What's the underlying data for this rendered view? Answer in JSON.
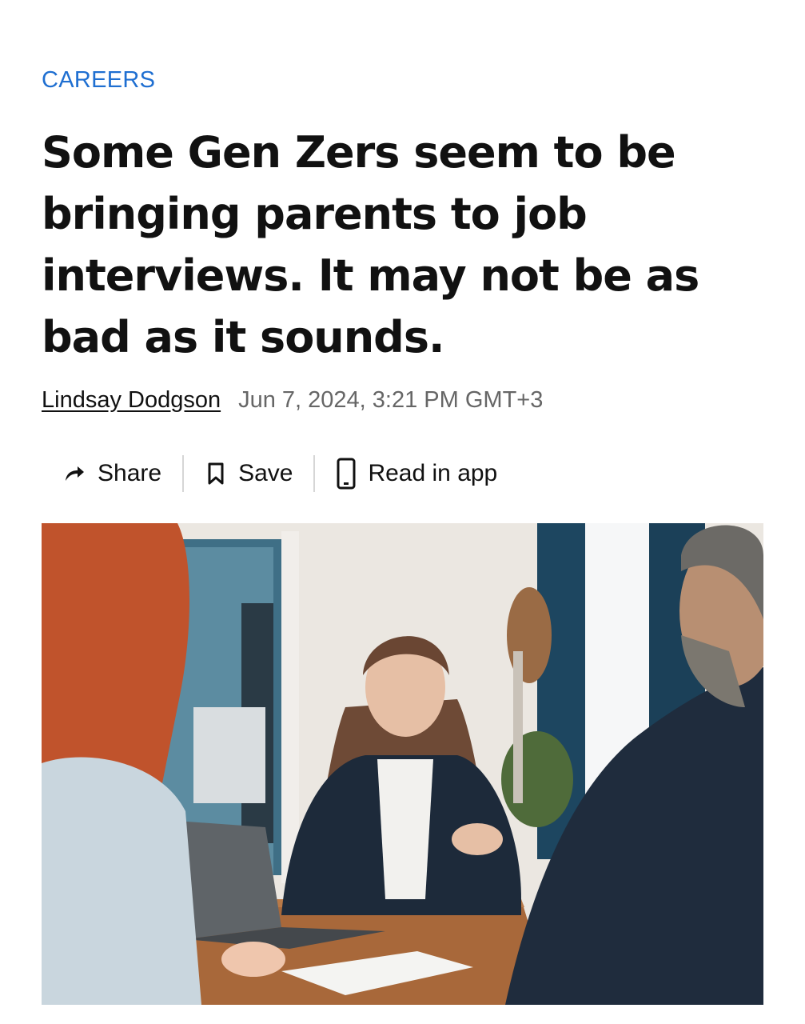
{
  "article": {
    "category": "CAREERS",
    "headline": "Some Gen Zers seem to be bringing parents to job interviews. It may not be as bad as it sounds.",
    "author": "Lindsay Dodgson",
    "date": "Jun 7, 2024, 3:21 PM GMT+3"
  },
  "actions": {
    "share_label": "Share",
    "save_label": "Save",
    "read_in_app_label": "Read in app",
    "share_icon": "share-arrow-icon",
    "save_icon": "bookmark-icon",
    "read_in_app_icon": "phone-icon"
  },
  "colors": {
    "category": "#1f6fd1",
    "headline": "#111111",
    "date": "#666666"
  }
}
